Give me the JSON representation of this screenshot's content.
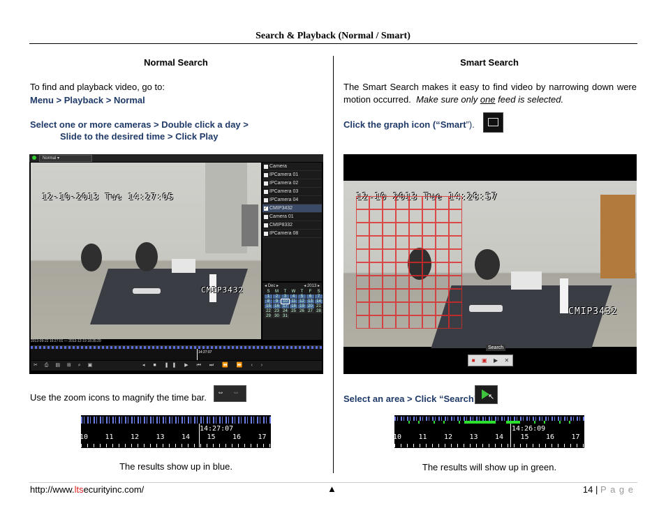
{
  "header": {
    "title": "Search & Playback (Normal / Smart)"
  },
  "left": {
    "heading": "Normal Search",
    "intro": "To find and playback video, go to:",
    "path": "Menu > Playback > Normal",
    "step_line1": "Select one or more cameras > Double click a day >",
    "step_line2": "Slide to the desired time > Click Play",
    "dvr": {
      "mode": "Normal",
      "timestamp": "12-10-2013 Tue 14:27:05",
      "camera_label": "CMIP3432",
      "cameras": [
        "Camera",
        "IPCamera 01",
        "IPCamera 02",
        "IPCamera 03",
        "IPCamera 04",
        "CMIP3432",
        "Camera 01",
        "CMIP8332",
        "IPCamera 08"
      ],
      "selected_camera": "CMIP3432",
      "calendar_month": "Dec",
      "calendar_year": "2013",
      "weekdays": [
        "S",
        "M",
        "T",
        "W",
        "T",
        "F",
        "S"
      ],
      "days": [
        "1",
        "2",
        "3",
        "4",
        "5",
        "6",
        "7",
        "8",
        "9",
        "10",
        "11",
        "12",
        "13",
        "14",
        "15",
        "16",
        "17",
        "18",
        "19",
        "20",
        "21",
        "22",
        "23",
        "24",
        "25",
        "26",
        "27",
        "28",
        "29",
        "30",
        "31"
      ],
      "range": "2013-09-22 16:27:01 — 2013-12-19 18:35:29",
      "cursor_time": "14:27:07"
    },
    "zoom_text": "Use the zoom icons to magnify the time bar.",
    "timebar": {
      "time": "14:27:07",
      "hours": [
        "10",
        "11",
        "12",
        "13",
        "14",
        "15",
        "16",
        "17"
      ]
    },
    "result": "The results show up in blue."
  },
  "right": {
    "heading": "Smart Search",
    "intro_plain": "The Smart Search makes it easy to find video by narrowing down were motion occurred.",
    "intro_italic_a": "Make sure only",
    "intro_italic_under": "one",
    "intro_italic_b": "feed is selected.",
    "click_prefix": "Click the graph icon (“",
    "click_smart": "Smart",
    "click_suffix": "”).",
    "cam": {
      "timestamp": "12-10 2013 Tue 14:28:57",
      "camera_label": "CMIP3432",
      "search_tooltip": "Search"
    },
    "select_text": "Select an area > Click “Search”",
    "timebar": {
      "time": "14:26:09",
      "hours": [
        "10",
        "11",
        "12",
        "13",
        "14",
        "15",
        "16",
        "17"
      ]
    },
    "result": "The results will show up in green."
  },
  "footer": {
    "url_pre": "http://www.",
    "url_red": "lts",
    "url_post": "ecurityinc.com/",
    "up_arrow": "▲",
    "page_number": "14",
    "page_sep": "|",
    "page_label": "P a g e"
  },
  "colors": {
    "heading_blue": "#1f3a68",
    "result_blue": "#6a7de6",
    "result_green": "#2ee02e",
    "url_red": "#e02020",
    "page_gray": "#999999"
  }
}
